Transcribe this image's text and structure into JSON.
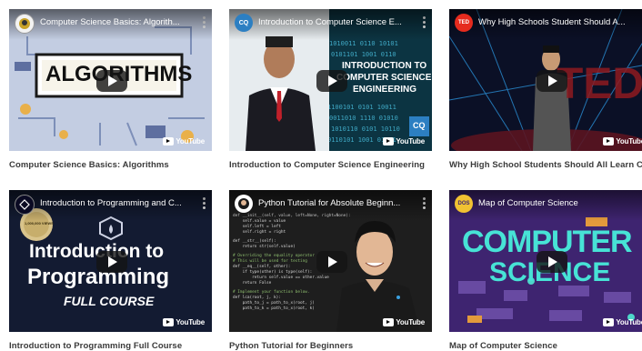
{
  "videos": [
    {
      "title": "Computer Science Basics: Algorithms",
      "video_title": "Computer Science Basics: Algorith...",
      "art_text": "ALGORITHMS",
      "channel_icon": "channel-avatar",
      "youtube_label": "YouTube"
    },
    {
      "title": "Introduction to Computer Science Engineering",
      "video_title": "Introduction to Computer Science E...",
      "art_text_1": "INTRODUCTION TO",
      "art_text_2": "COMPUTER SCIENCE",
      "art_text_3": "ENGINEERING",
      "channel_badge": "CQ",
      "corner_badge": "CQ",
      "youtube_label": "YouTube"
    },
    {
      "title": "Why High School Students Should All Learn CS",
      "video_title": "Why High Schools Student Should A...",
      "channel_badge": "TED",
      "art_text": "TEDx",
      "youtube_label": "YouTube"
    },
    {
      "title": "Introduction to Programming Full Course",
      "video_title": "Introduction to Programming and C...",
      "art_text_1": "Introduction to",
      "art_text_2": "Programming",
      "art_text_3": "FULL COURSE",
      "seal_text": "1,000,000 VIEWS",
      "youtube_label": "YouTube"
    },
    {
      "title": "Python Tutorial for Beginners",
      "video_title": "Python Tutorial for Absolute Beginn...",
      "code_lines": [
        "def __init__(self, value, left=None, right=None):",
        "    self.value = value",
        "    self.left = left",
        "    self.right = right",
        "def __str__(self):",
        "    return str(self.value)",
        "# Overriding the equality operator",
        "# This will be used for testing",
        "def __eq__(self, other):",
        "    if type(other) is type(self):",
        "        return self.value == other.value",
        "    return False",
        "# Implement your function below.",
        "def lca(root, j, k):",
        "    path_to_j = path_to_x(root, j)",
        "    path_to_k = path_to_x(root, k)"
      ],
      "youtube_label": "YouTube"
    },
    {
      "title": "Map of Computer Science",
      "video_title": "Map of Computer Science",
      "channel_badge": "DOS",
      "art_text_1": "COMPUTER",
      "art_text_2": "SCIENCE",
      "youtube_label": "YouTube"
    }
  ]
}
